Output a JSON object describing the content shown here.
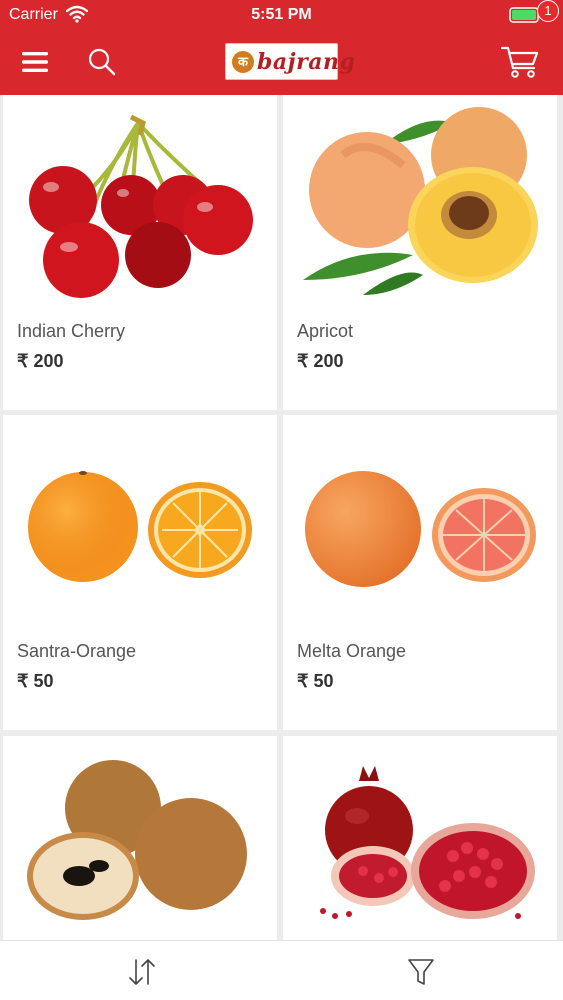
{
  "status_bar": {
    "carrier": "Carrier",
    "time": "5:51 PM"
  },
  "header": {
    "logo_text": "bajrang",
    "cart_count": "1",
    "accent_color": "#d9272e"
  },
  "products": [
    {
      "name": "Indian Cherry",
      "price": "₹ 200",
      "image": "cherry-image"
    },
    {
      "name": "Apricot",
      "price": "₹ 200",
      "image": "apricot-image"
    },
    {
      "name": "Santra-Orange",
      "price": "₹ 50",
      "image": "orange-image"
    },
    {
      "name": "Melta Orange",
      "price": "₹ 50",
      "image": "grapefruit-image"
    },
    {
      "name": "",
      "price": "",
      "image": "sapodilla-image"
    },
    {
      "name": "",
      "price": "",
      "image": "pomegranate-image"
    }
  ],
  "bottom_bar": {
    "icons": [
      "sort-icon",
      "filter-icon"
    ]
  }
}
